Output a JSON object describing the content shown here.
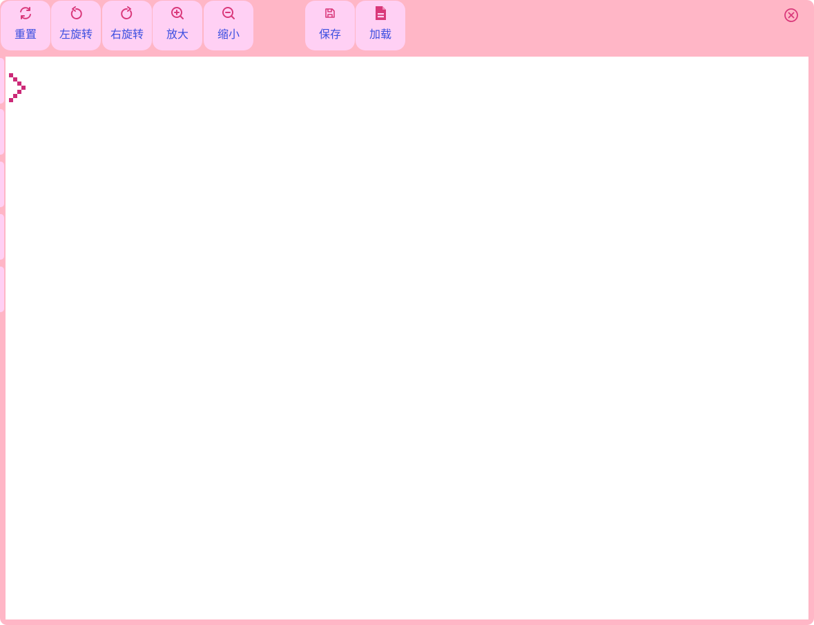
{
  "toolbar": {
    "reset_label": "重置",
    "rotate_left_label": "左旋转",
    "rotate_right_label": "右旋转",
    "zoom_in_label": "放大",
    "zoom_out_label": "缩小",
    "save_label": "保存",
    "load_label": "加载"
  },
  "icons": {
    "reset": "refresh-icon",
    "rotate_left": "rotate-left-icon",
    "rotate_right": "rotate-right-icon",
    "zoom_in": "zoom-in-icon",
    "zoom_out": "zoom-out-icon",
    "save": "floppy-disk-icon",
    "load": "document-icon",
    "close": "close-circle-icon",
    "cursor": "pixel-chevron-right-icon"
  },
  "colors": {
    "frame": "#ffb6c6",
    "button_bg": "#ffd0f4",
    "icon": "#d9387a",
    "label": "#3b4fe0",
    "canvas": "#ffffff",
    "cursor": "#cc2a78"
  }
}
